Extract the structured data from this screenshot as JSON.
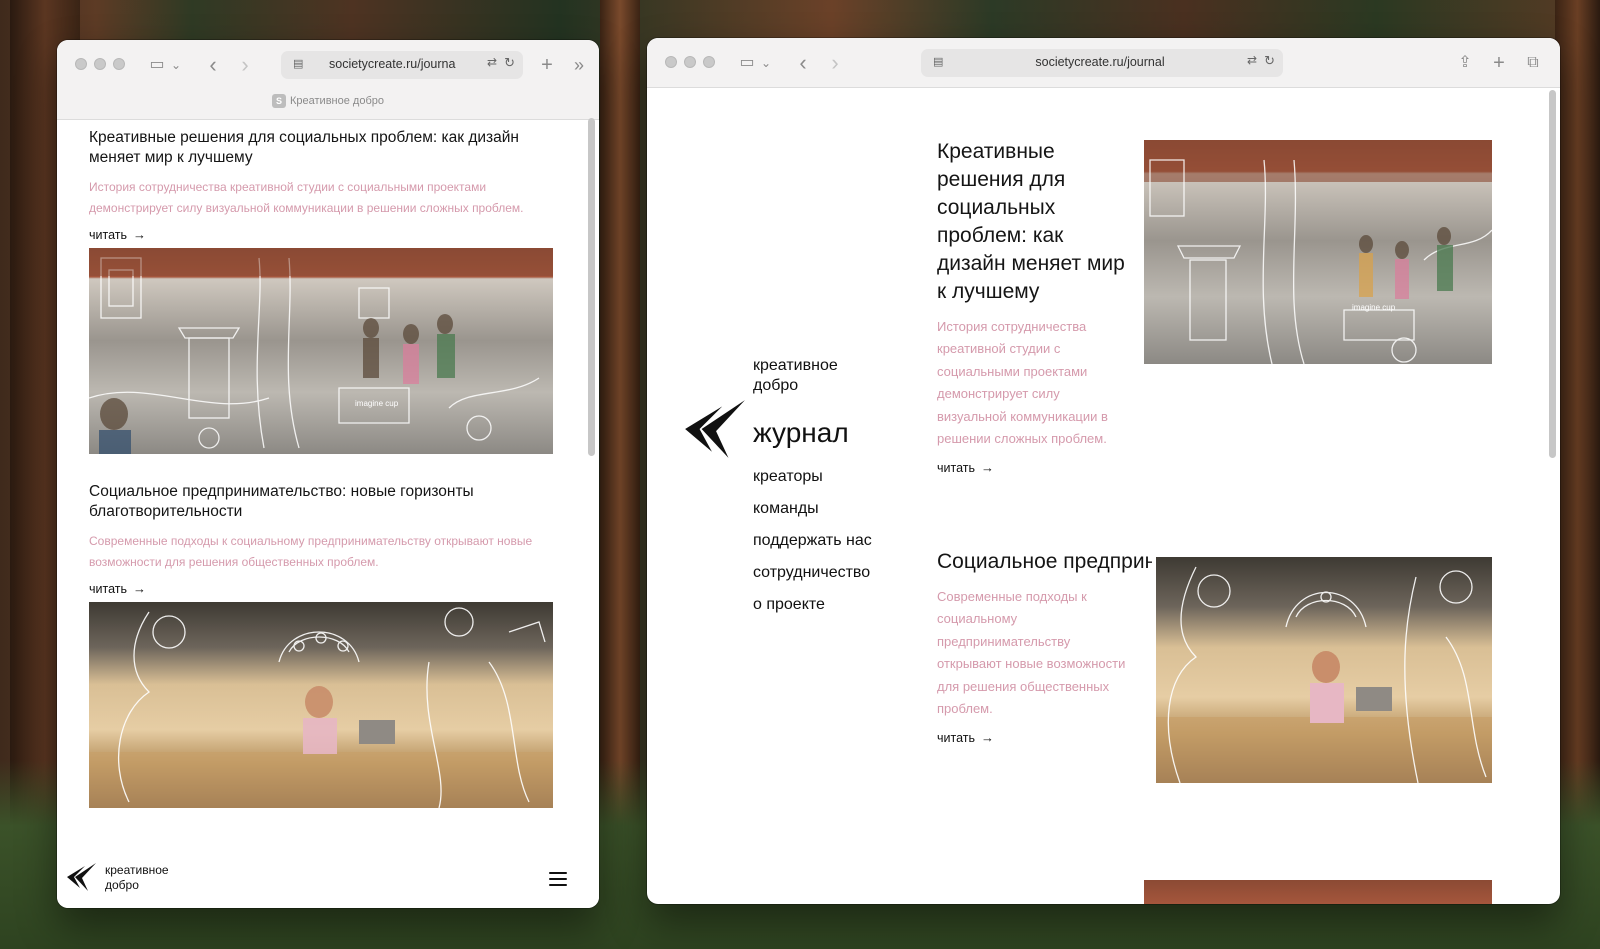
{
  "site_title": "Креативное добро",
  "favicon_letter": "S",
  "left_window": {
    "url": "societycreate.ru/journal",
    "url_display": "societycreate.ru/journa",
    "articles": [
      {
        "title": "Креативные решения для социальных проблем: как дизайн меняет мир к лучшему",
        "description": "История сотрудничества креативной студии с социальными проектами демонстрирует силу визуальной коммуникации в решении сложных проблем.",
        "read_label": "читать"
      },
      {
        "title": "Социальное предпринимательство: новые горизонты благотворительности",
        "description": "Современные подходы к социальному предпринимательству открывают новые возможности для решения общественных проблем.",
        "read_label": "читать"
      }
    ],
    "footer_brand_line1": "креативное",
    "footer_brand_line2": "добро"
  },
  "right_window": {
    "url": "societycreate.ru/journal",
    "nav": {
      "brand_line1": "креативное",
      "brand_line2": "добро",
      "current": "журнал",
      "items": [
        "креаторы",
        "команды",
        "поддержать нас",
        "сотрудничество",
        "о проекте"
      ]
    },
    "articles": [
      {
        "title": "Креативные решения для социальных проблем: как дизайн меняет мир к лучшему",
        "description": "История сотрудничества креативной студии с социальными проектами демонстрирует силу визуальной коммуникации в решении сложных проблем.",
        "read_label": "читать"
      },
      {
        "title": "Социальное предпринимательство: новые горизонты благотворительности",
        "description": "Современные подходы к социальному предпринимательству открывают новые возможности для решения общественных проблем.",
        "read_label": "читать"
      }
    ]
  },
  "image_caption": "imagine cup",
  "icons": {
    "arrow": "→",
    "back": "‹",
    "forward": "›",
    "new_tab": "+",
    "more_tabs": "»",
    "reload": "↻",
    "translate": "⇄",
    "share": "⇪",
    "sidebar": "▭",
    "tabs_overview": "⧉",
    "dropdown": "⌄"
  },
  "colors": {
    "accent_pink": "#d59aac",
    "text": "#111111",
    "toolbar_bg": "#f3f2f2"
  }
}
